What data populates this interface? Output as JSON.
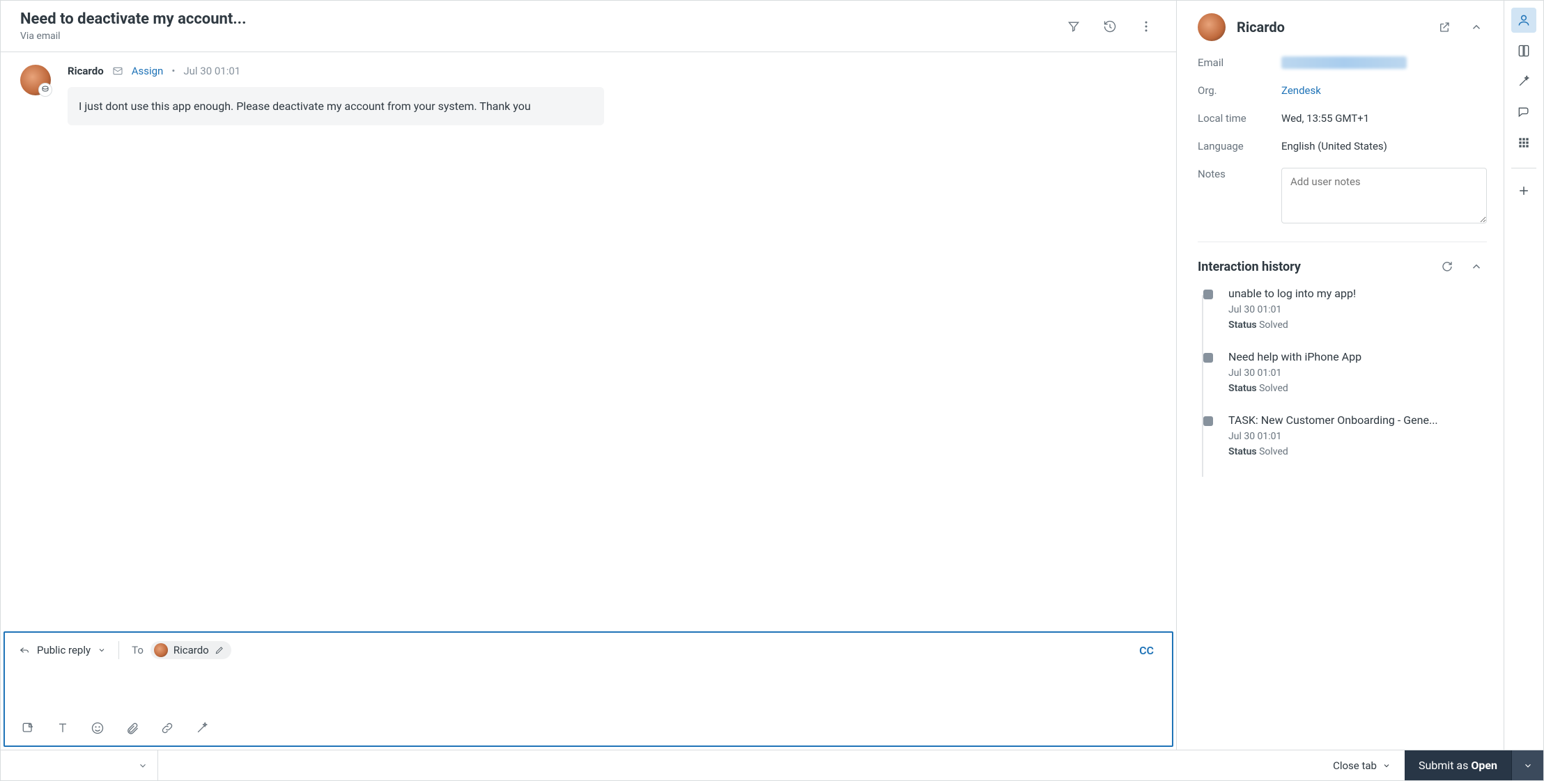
{
  "ticket": {
    "title": "Need to deactivate my account...",
    "via": "Via email"
  },
  "message": {
    "author": "Ricardo",
    "assign_label": "Assign",
    "timestamp": "Jul 30 01:01",
    "body": "I just dont use this app enough. Please deactivate my account from your system. Thank you"
  },
  "composer": {
    "reply_type": "Public reply",
    "to_label": "To",
    "to_name": "Ricardo",
    "cc_label": "CC"
  },
  "user": {
    "name": "Ricardo",
    "fields": {
      "email_label": "Email",
      "org_label": "Org.",
      "org_value": "Zendesk",
      "localtime_label": "Local time",
      "localtime_value": "Wed, 13:55 GMT+1",
      "language_label": "Language",
      "language_value": "English (United States)",
      "notes_label": "Notes",
      "notes_placeholder": "Add user notes"
    }
  },
  "history": {
    "title": "Interaction history",
    "status_label": "Status",
    "items": [
      {
        "title": "unable to log into my app!",
        "ts": "Jul 30 01:01",
        "status": "Solved"
      },
      {
        "title": "Need help with iPhone App",
        "ts": "Jul 30 01:01",
        "status": "Solved"
      },
      {
        "title": "TASK: New Customer Onboarding - Gene...",
        "ts": "Jul 30 01:01",
        "status": "Solved"
      }
    ]
  },
  "footer": {
    "close_tab": "Close tab",
    "submit_prefix": "Submit as",
    "submit_status": "Open"
  }
}
